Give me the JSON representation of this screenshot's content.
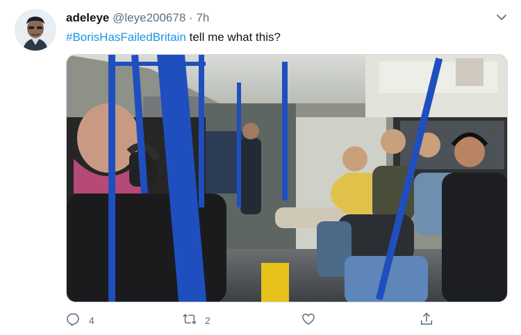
{
  "tweet": {
    "display_name": "adeleye",
    "handle": "@leye200678",
    "separator": "·",
    "time": "7h",
    "hashtag": "#BorisHasFailedBritain",
    "text": " tell me what this?",
    "media_icon": "photo-subway-passengers",
    "actions": {
      "reply_count": "4",
      "retweet_count": "2"
    },
    "colors": {
      "accent": "#1b95e0",
      "pole_blue": "#1f4fbf",
      "muted": "#5b7083"
    }
  }
}
